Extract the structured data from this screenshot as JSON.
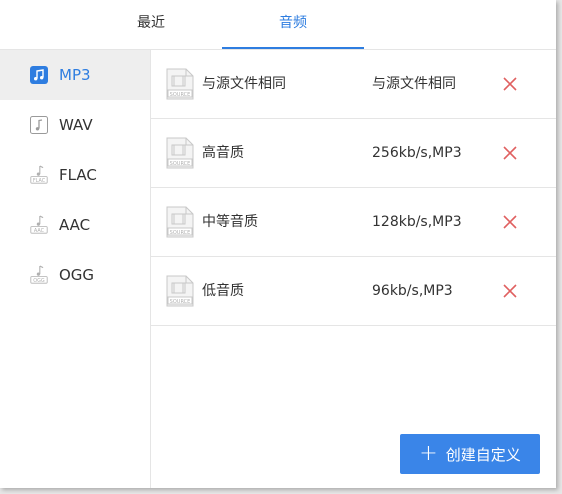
{
  "tabs": [
    {
      "label": "最近"
    },
    {
      "label": "音频"
    }
  ],
  "sidebar": {
    "items": [
      {
        "label": "MP3",
        "icon": "music-note-icon"
      },
      {
        "label": "WAV",
        "icon": "music-note-icon"
      },
      {
        "label": "FLAC",
        "icon": "flac-file-icon",
        "icon_text": "FLAC"
      },
      {
        "label": "AAC",
        "icon": "aac-file-icon",
        "icon_text": "AAC"
      },
      {
        "label": "OGG",
        "icon": "ogg-file-icon",
        "icon_text": "OGG"
      }
    ]
  },
  "presets": [
    {
      "name": "与源文件相同",
      "detail": "与源文件相同"
    },
    {
      "name": "高音质",
      "detail": "256kb/s,MP3"
    },
    {
      "name": "中等音质",
      "detail": "128kb/s,MP3"
    },
    {
      "name": "低音质",
      "detail": "96kb/s,MP3"
    }
  ],
  "preset_icon_text": "SOURCE",
  "create_button": {
    "label": "创建自定义"
  },
  "colors": {
    "accent": "#2e7de0",
    "delete": "#e06060",
    "button": "#3a85e8"
  }
}
